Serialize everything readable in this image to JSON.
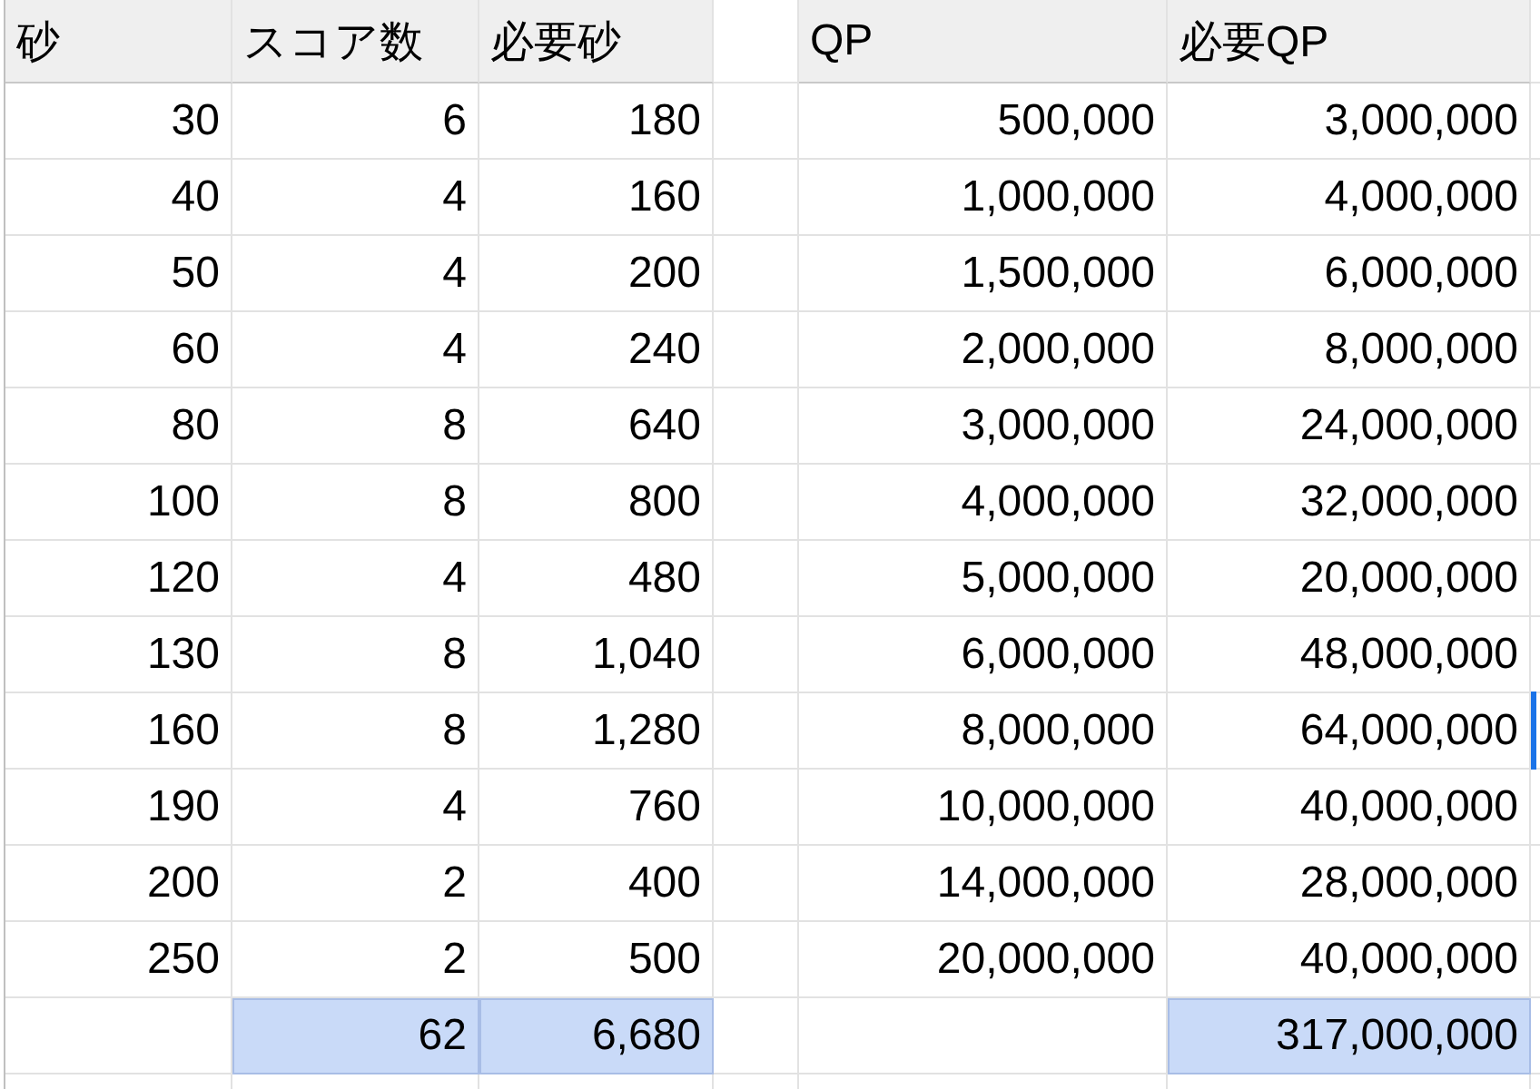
{
  "columns": [
    "砂",
    "スコア数",
    "必要砂",
    "QP",
    "必要QP"
  ],
  "rows": [
    {
      "kind": "data",
      "selected": false,
      "sand": "30",
      "score_count": "6",
      "required_sand": "180",
      "qp": "500,000",
      "required_qp": "3,000,000"
    },
    {
      "kind": "data",
      "selected": false,
      "sand": "40",
      "score_count": "4",
      "required_sand": "160",
      "qp": "1,000,000",
      "required_qp": "4,000,000"
    },
    {
      "kind": "data",
      "selected": false,
      "sand": "50",
      "score_count": "4",
      "required_sand": "200",
      "qp": "1,500,000",
      "required_qp": "6,000,000"
    },
    {
      "kind": "data",
      "selected": false,
      "sand": "60",
      "score_count": "4",
      "required_sand": "240",
      "qp": "2,000,000",
      "required_qp": "8,000,000"
    },
    {
      "kind": "data",
      "selected": false,
      "sand": "80",
      "score_count": "8",
      "required_sand": "640",
      "qp": "3,000,000",
      "required_qp": "24,000,000"
    },
    {
      "kind": "data",
      "selected": false,
      "sand": "100",
      "score_count": "8",
      "required_sand": "800",
      "qp": "4,000,000",
      "required_qp": "32,000,000"
    },
    {
      "kind": "data",
      "selected": false,
      "sand": "120",
      "score_count": "4",
      "required_sand": "480",
      "qp": "5,000,000",
      "required_qp": "20,000,000"
    },
    {
      "kind": "data",
      "selected": false,
      "sand": "130",
      "score_count": "8",
      "required_sand": "1,040",
      "qp": "6,000,000",
      "required_qp": "48,000,000"
    },
    {
      "kind": "data",
      "selected": true,
      "sand": "160",
      "score_count": "8",
      "required_sand": "1,280",
      "qp": "8,000,000",
      "required_qp": "64,000,000"
    },
    {
      "kind": "data",
      "selected": false,
      "sand": "190",
      "score_count": "4",
      "required_sand": "760",
      "qp": "10,000,000",
      "required_qp": "40,000,000"
    },
    {
      "kind": "data",
      "selected": false,
      "sand": "200",
      "score_count": "2",
      "required_sand": "400",
      "qp": "14,000,000",
      "required_qp": "28,000,000"
    },
    {
      "kind": "data",
      "selected": false,
      "sand": "250",
      "score_count": "2",
      "required_sand": "500",
      "qp": "20,000,000",
      "required_qp": "40,000,000"
    },
    {
      "kind": "total",
      "selected": false,
      "score_count": "62",
      "required_sand": "6,680",
      "required_qp": "317,000,000"
    }
  ]
}
